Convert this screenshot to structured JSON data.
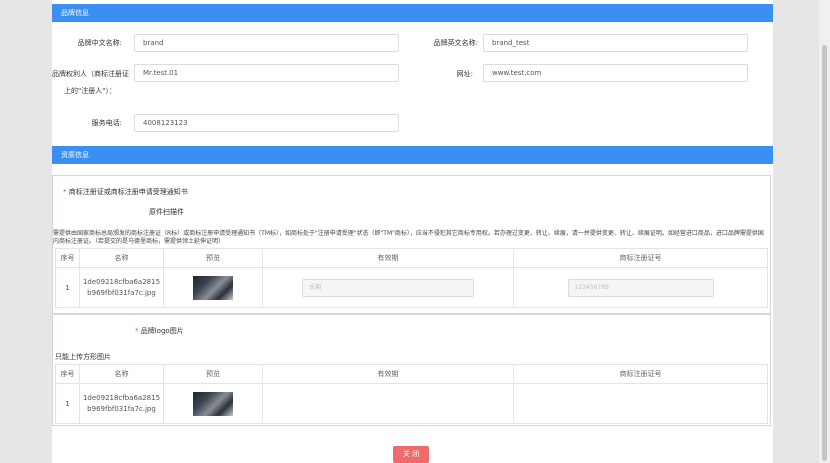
{
  "brand_info": {
    "header": "品牌信息",
    "cn_name_label": "品牌中文名称:",
    "cn_name_value": "brand",
    "en_name_label": "品牌英文名称:",
    "en_name_value": "brand_test",
    "owner_label_line1": "品牌权利人（商标注册证",
    "owner_label_line2": "上的\"注册人\"）：",
    "owner_value": "Mr.test.01",
    "website_label": "网址:",
    "website_value": "www.test.com",
    "phone_label": "服务电话:",
    "phone_value": "4008123123"
  },
  "qualification": {
    "header": "资质信息",
    "cert_section": {
      "required_mark": "*",
      "title": "商标注册证或商标注册申请受理通知书",
      "subtitle": "原件扫描件",
      "notice": "需提供由国家商标总局颁发的商标注册证（R标）或商标注册申请受理通知书（TM标），如商标处于\"注册申请受理\"状态（即\"TM\"商标），应当不侵犯其它商标专用权。若办理过变更、转让、续展，请一并提供变更、转让、续展证明。如经营进口商品，进口品牌需提供国内商标注册证。（若提交的是马德里商标，需提供领土延伸证明）",
      "columns": [
        "序号",
        "名称",
        "预览",
        "有效期",
        "商标注册证号"
      ],
      "rows": [
        {
          "index": "1",
          "name_line1": "1de09218cfba6a2815",
          "name_line2": "b969fbf031fa7c.jpg",
          "validity_placeholder": "长期",
          "reg_no_placeholder": "123456789"
        }
      ]
    },
    "logo_section": {
      "required_mark": "*",
      "title": "品牌logo图片",
      "note": "只能上传方形图片",
      "columns": [
        "序号",
        "名称",
        "预览",
        "有效期",
        "商标注册证号"
      ],
      "rows": [
        {
          "index": "1",
          "name_line1": "1de09218cfba6a2815",
          "name_line2": "b969fbf031fa7c.jpg"
        }
      ]
    }
  },
  "close_button": "关 闭"
}
